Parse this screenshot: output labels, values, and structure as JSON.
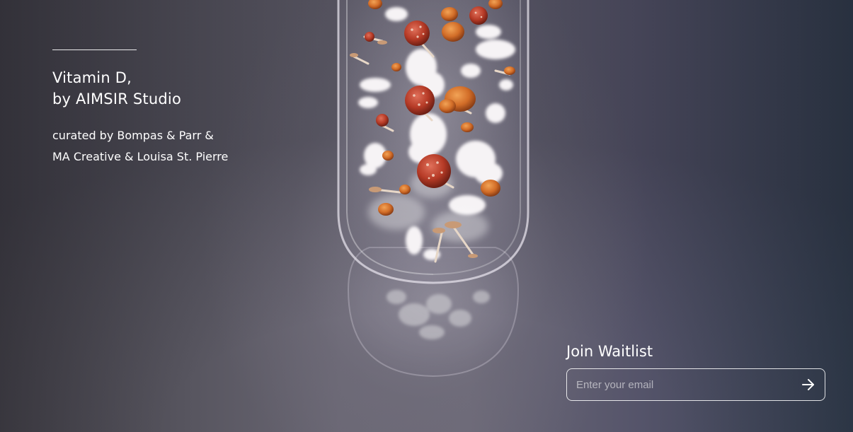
{
  "intro": {
    "title_lines": [
      "Vitamin D,",
      "by AIMSIR Studio"
    ],
    "curator_lines": [
      "curated by Bompas & Parr &",
      "MA Creative & Louisa St. Pierre"
    ]
  },
  "waitlist": {
    "heading": "Join Waitlist",
    "email_placeholder": "Enter your email",
    "email_value": "",
    "submit_icon": "arrow-right-icon"
  },
  "artwork": {
    "subject": "capsule-with-mushrooms",
    "colors": {
      "mushroom_cap": "#b8422c",
      "mushroom_orange": "#d9732a",
      "fluff": "#f4f1f3"
    }
  }
}
